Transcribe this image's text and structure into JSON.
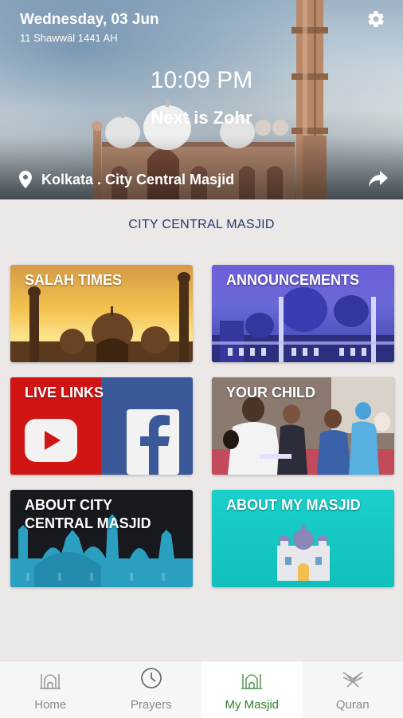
{
  "header": {
    "date": "Wednesday, 03 Jun",
    "hijri_date": "11 Shawwāl 1441 AH",
    "time": "10:09 PM",
    "next_prayer": "Next is Zohr",
    "location": "Kolkata . City Central Masjid",
    "icons": {
      "settings": "gear-icon",
      "location": "location-pin-icon",
      "share": "share-icon"
    }
  },
  "section_title": "CITY CENTRAL MASJID",
  "tiles": [
    {
      "label": "SALAH TIMES"
    },
    {
      "label": "ANNOUNCEMENTS"
    },
    {
      "label": "LIVE LINKS"
    },
    {
      "label": "YOUR CHILD"
    },
    {
      "label": "ABOUT CITY CENTRAL MASJID"
    },
    {
      "label": "ABOUT MY MASJID"
    }
  ],
  "nav": {
    "items": [
      {
        "label": "Home",
        "icon": "mosque-icon"
      },
      {
        "label": "Prayers",
        "icon": "clock-icon"
      },
      {
        "label": "My Masjid",
        "icon": "mosque-icon"
      },
      {
        "label": "Quran",
        "icon": "quran-icon"
      }
    ],
    "active": "My Masjid"
  },
  "colors": {
    "section_title": "#243a66",
    "nav_active": "#2f7d2f",
    "nav_inactive": "#8a8a8a",
    "live_links_red": "#c91212",
    "facebook_blue": "#3b5998",
    "about_my_masjid_teal": "#1bd0cb"
  }
}
